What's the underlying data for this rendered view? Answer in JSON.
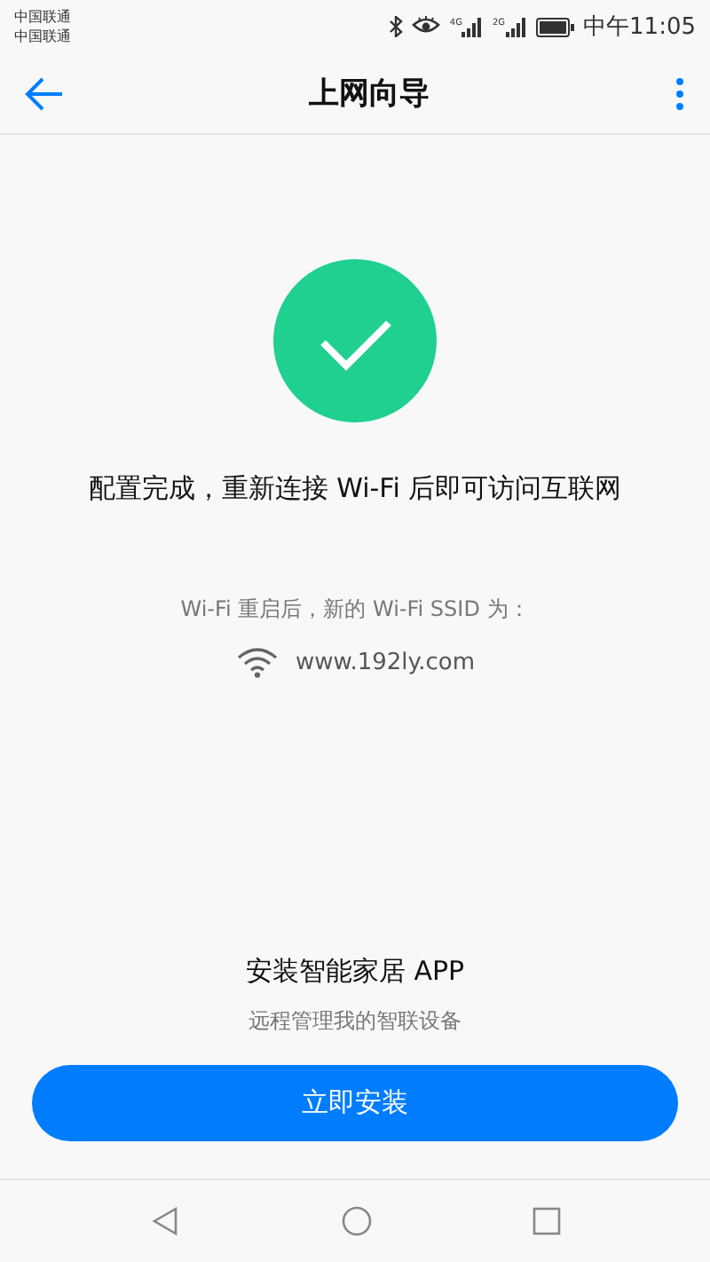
{
  "status_bar": {
    "carriers": [
      "中国联通",
      "中国联通"
    ],
    "network_labels": [
      "4G",
      "2G"
    ],
    "time": "中午11:05"
  },
  "header": {
    "title": "上网向导"
  },
  "result": {
    "message": "配置完成，重新连接 Wi-Fi 后即可访问互联网",
    "note": "Wi-Fi 重启后，新的 Wi-Fi SSID 为：",
    "ssid": "www.192ly.com"
  },
  "promo": {
    "title": "安装智能家居 APP",
    "subtitle": "远程管理我的智联设备",
    "button": "立即安装"
  }
}
